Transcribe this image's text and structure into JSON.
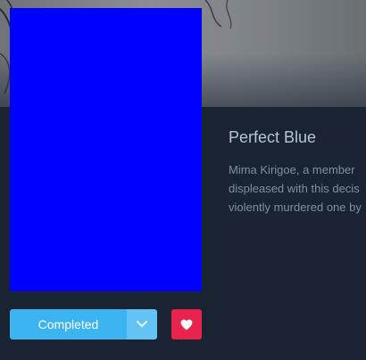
{
  "banner": {
    "icon": "artwork-sketch"
  },
  "media": {
    "title": "Perfect Blue",
    "description_lines": [
      "Mima Kirigoe, a member",
      "displeased with this decis",
      "violently murdered one by"
    ]
  },
  "actions": {
    "status_label": "Completed",
    "dropdown_icon": "chevron-down-icon",
    "favourite_icon": "heart-icon"
  },
  "colors": {
    "background": "#1a2332",
    "cover": "#0000ff",
    "status_button": "#3db4f2",
    "favourite_button": "#e8234e"
  }
}
